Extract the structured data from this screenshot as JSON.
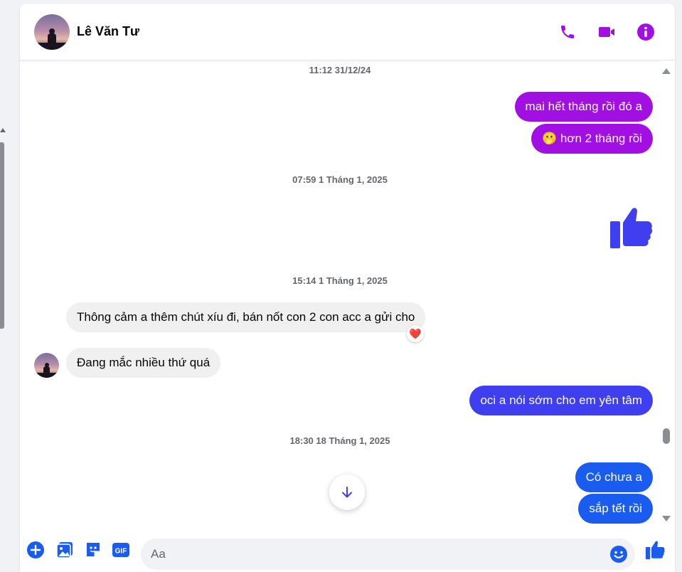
{
  "header": {
    "contact_name": "Lê Văn Tư"
  },
  "icons": {
    "call": "phone-icon",
    "video": "video-call-icon",
    "info": "info-icon",
    "scroll_down": "arrow-down-icon",
    "add": "plus-circle-icon",
    "photo": "photo-icon",
    "sticker": "sticker-icon",
    "gif": "gif-icon",
    "emoji": "emoji-icon",
    "like": "thumbs-up-icon"
  },
  "colors": {
    "accent": "#a20fe3",
    "blue_bubble": "#1a5cf0",
    "indigo_bubble": "#3f3ff0",
    "incoming_bubble": "#f0f0f0"
  },
  "timestamps": [
    "11:12 31/12/24",
    "07:59 1 Tháng 1, 2025",
    "15:14 1 Tháng 1, 2025",
    "18:30 18 Tháng 1, 2025"
  ],
  "messages": [
    {
      "direction": "out",
      "text": "mai hết tháng rồi đó a"
    },
    {
      "direction": "out",
      "emoji": "🫢",
      "text": "hơn 2 tháng rồi"
    },
    {
      "direction": "out",
      "type": "like-sticker"
    },
    {
      "direction": "in",
      "text": "Thông cảm a thêm chút xíu đi, bán nốt con 2 con acc a gửi cho",
      "reaction": "❤️"
    },
    {
      "direction": "in",
      "text": "Đang mắc nhiều thứ quá"
    },
    {
      "direction": "out",
      "text": "oci a nói sớm cho em yên tâm"
    },
    {
      "direction": "out",
      "text": "Có chưa a"
    },
    {
      "direction": "out",
      "text": "sắp tết rồi"
    }
  ],
  "composer": {
    "placeholder": "Aa",
    "value": ""
  }
}
